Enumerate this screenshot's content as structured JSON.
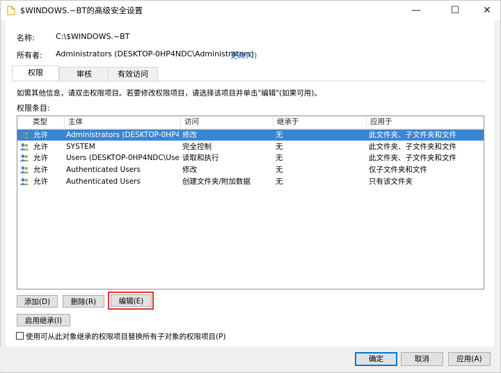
{
  "window": {
    "title": "$WINDOWS.~BT的高级安全设置",
    "minimize": "—",
    "maximize": "☐",
    "close": "✕"
  },
  "info": {
    "name_label": "名称:",
    "name_value": "C:\\$WINDOWS.~BT",
    "owner_label": "所有者:",
    "owner_value": "Administrators (DESKTOP-0HP4NDC\\Administrators)",
    "change_link": "更改(C)"
  },
  "tabs": [
    {
      "label": "权限",
      "active": true
    },
    {
      "label": "审核",
      "active": false
    },
    {
      "label": "有效访问",
      "active": false
    }
  ],
  "instructions": "如需其他信息，请双击权限项目。若要修改权限项目，请选择该项目并单击\"编辑\"(如果可用)。",
  "entries_label": "权限条目:",
  "table": {
    "headers": [
      "类型",
      "主体",
      "访问",
      "继承于",
      "应用于"
    ],
    "rows": [
      {
        "type": "允许",
        "principal": "Administrators (DESKTOP-0HP4...",
        "access": "修改",
        "inherited": "无",
        "applies": "此文件夹、子文件夹和文件",
        "selected": true
      },
      {
        "type": "允许",
        "principal": "SYSTEM",
        "access": "完全控制",
        "inherited": "无",
        "applies": "此文件夹、子文件夹和文件",
        "selected": false
      },
      {
        "type": "允许",
        "principal": "Users (DESKTOP-0HP4NDC\\User...",
        "access": "读取和执行",
        "inherited": "无",
        "applies": "此文件夹、子文件夹和文件",
        "selected": false
      },
      {
        "type": "允许",
        "principal": "Authenticated Users",
        "access": "修改",
        "inherited": "无",
        "applies": "仅子文件夹和文件",
        "selected": false
      },
      {
        "type": "允许",
        "principal": "Authenticated Users",
        "access": "创建文件夹/附加数据",
        "inherited": "无",
        "applies": "只有该文件夹",
        "selected": false
      }
    ]
  },
  "buttons": {
    "add": "添加(D)",
    "remove": "删除(R)",
    "edit": "编辑(E)",
    "enable_inheritance": "启用继承(I)",
    "ok": "确定",
    "cancel": "取消",
    "apply": "应用(A)"
  },
  "replace_checkbox": {
    "label": "使用可从此对象继承的权限项目替换所有子对象的权限项目(P)",
    "checked": false
  },
  "colors": {
    "selection": "#3b85d2",
    "link": "#1a5fb4",
    "highlight_box": "#e23232",
    "accent": "#0078d7"
  }
}
